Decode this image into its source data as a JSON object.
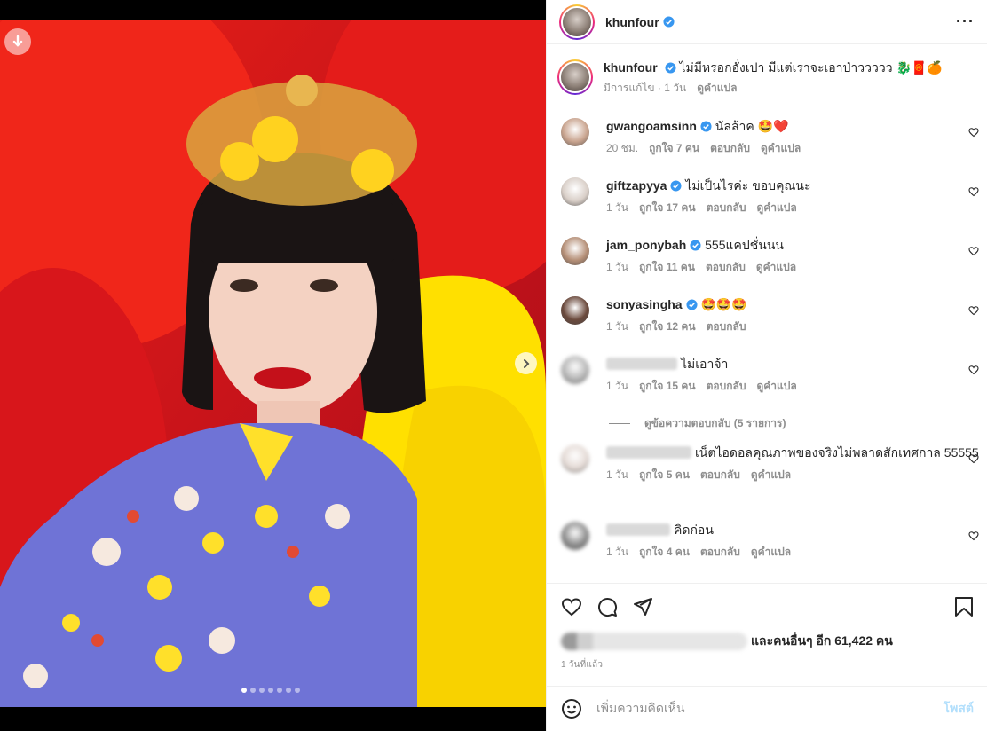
{
  "post": {
    "username": "khunfour",
    "more_icon": "more-horizontal-icon"
  },
  "caption": {
    "username": "khunfour",
    "text": "ไม่มีหรอกอั่งเปา มีแต่เราจะเอาป่าววววว 🐉🧧🍊",
    "meta_edited": "มีการแก้ไข · 1 วัน",
    "meta_translate": "ดูคำแปล"
  },
  "comments": [
    {
      "username": "gwangoamsinn",
      "text": "นัลล้าค 🤩❤️",
      "time": "20 ชม.",
      "likes": "ถูกใจ 7 คน",
      "reply": "ตอบกลับ",
      "translate": "ดูคำแปล",
      "avatar_color": "#c9a48f"
    },
    {
      "username": "giftzapyya",
      "text": "ไม่เป็นไรค่ะ ขอบคุณนะ",
      "time": "1 วัน",
      "likes": "ถูกใจ 17 คน",
      "reply": "ตอบกลับ",
      "translate": "ดูคำแปล",
      "avatar_color": "#d9cfc8"
    },
    {
      "username": "jam_ponybah",
      "text": "555แคปชั่นนน",
      "time": "1 วัน",
      "likes": "ถูกใจ 11 คน",
      "reply": "ตอบกลับ",
      "translate": "ดูคำแปล",
      "avatar_color": "#b58f77"
    },
    {
      "username": "sonyasingha",
      "text": "🤩🤩🤩",
      "time": "1 วัน",
      "likes": "ถูกใจ 12 คน",
      "reply": "ตอบกลับ",
      "translate": "",
      "avatar_color": "#6b4a3d"
    },
    {
      "username": "",
      "text": "ไม่เอาจ้า",
      "time": "1 วัน",
      "likes": "ถูกใจ 15 คน",
      "reply": "ตอบกลับ",
      "translate": "ดูคำแปล",
      "avatar_color": "#b5b5b5"
    },
    {
      "username": "",
      "text": "เน็ตไอดอลคุณภาพของจริงไม่พลาดสักเทศกาล 55555",
      "time": "1 วัน",
      "likes": "ถูกใจ 5 คน",
      "reply": "ตอบกลับ",
      "translate": "ดูคำแปล",
      "avatar_color": "#e4dad5"
    },
    {
      "username": "",
      "text": "คิดก่อน",
      "time": "1 วัน",
      "likes": "ถูกใจ 4 คน",
      "reply": "ตอบกลับ",
      "translate": "ดูคำแปล",
      "avatar_color": "#8a8a8a"
    }
  ],
  "view_replies": "ดูข้อความตอบกลับ (5 รายการ)",
  "likes": {
    "text": "และคนอื่นๆ อีก 61,422 คน"
  },
  "posted_time": "1 วันที่แล้ว",
  "add_comment": {
    "placeholder": "เพิ่มความคิดเห็น",
    "post_label": "โพสต์"
  },
  "carousel": {
    "slide_count": 7,
    "current_slide": 1
  },
  "colors": {
    "verified": "#3897f0",
    "post_button": "#b2dffc",
    "muted": "#8e8e8e"
  }
}
